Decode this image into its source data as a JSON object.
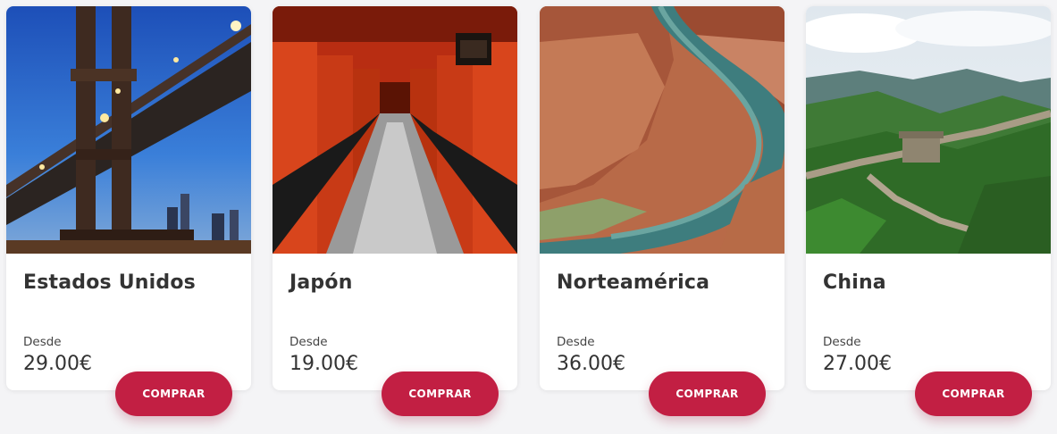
{
  "accent_color": "#c21f43",
  "cards": [
    {
      "title": "Estados Unidos",
      "price_label": "Desde",
      "price": "29.00€",
      "button": "COMPRAR",
      "image_icon": "brooklyn-bridge-photo"
    },
    {
      "title": "Japón",
      "price_label": "Desde",
      "price": "19.00€",
      "button": "COMPRAR",
      "image_icon": "torii-gates-photo"
    },
    {
      "title": "Norteamérica",
      "price_label": "Desde",
      "price": "36.00€",
      "button": "COMPRAR",
      "image_icon": "horseshoe-bend-photo"
    },
    {
      "title": "China",
      "price_label": "Desde",
      "price": "27.00€",
      "button": "COMPRAR",
      "image_icon": "great-wall-photo"
    }
  ]
}
